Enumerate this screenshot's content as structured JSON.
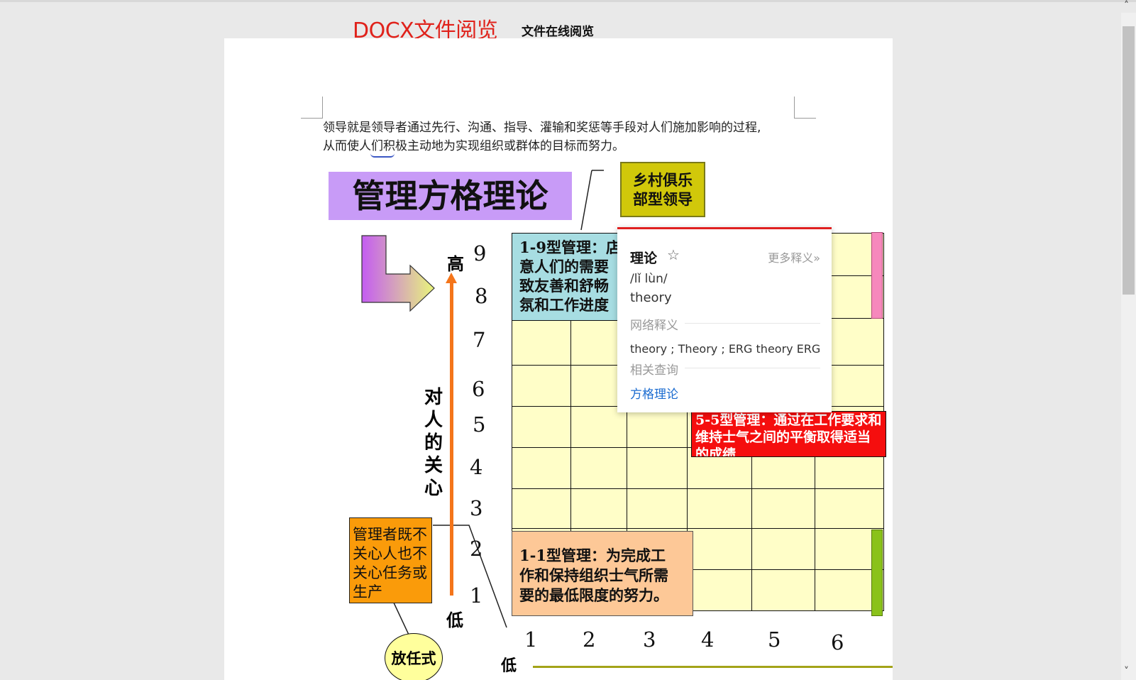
{
  "header": {
    "app_title": "DOCX文件阅览",
    "subtitle": "文件在线阅览"
  },
  "document": {
    "paragraph_line1": "领导就是领导者通过先行、沟通、指导、灌输和奖惩等手段对人们施加影响的过程,",
    "paragraph_line2": "从而使人们积极主动地为实现组织或群体的目标而努力。",
    "figure": {
      "title": "管理方格理论",
      "country_club_line1": "乡村俱乐",
      "country_club_line2": "部型领导",
      "box_1_9": [
        "1-9型管理：店",
        "意人们的需要",
        "致友善和舒畅",
        "氛和工作进度"
      ],
      "box_5_5": [
        "5-5型管理：通过在工作要求和",
        "维持士气之间的平衡取得适当",
        "的成绩"
      ],
      "box_1_1": [
        "1-1型管理：为完成工",
        "作和保持组织士气所需",
        "要的最低限度的努力。"
      ],
      "box_laissez": [
        "管理者既不",
        "关心人也不",
        "关心任务或",
        "生产"
      ],
      "bubble": "放任式",
      "y_high": "高",
      "y_low": "低",
      "x_low": "低",
      "y_axis_label": "对人的关心",
      "y_ticks": [
        "9",
        "8",
        "7",
        "6",
        "5",
        "4",
        "3",
        "2",
        "1"
      ],
      "x_ticks": [
        "1",
        "2",
        "3",
        "4",
        "5",
        "6"
      ]
    }
  },
  "dictionary_popup": {
    "word": "理论",
    "star_icon": "star-outline-icon",
    "more_link": "更多释义»",
    "phonetic": "/lǐ lùn/",
    "definition": "theory",
    "web_section": "网络释义",
    "web_meanings": "theory ; Theory ; ERG theory ERG",
    "related_section": "相关查询",
    "related_link": "方格理论"
  },
  "colors": {
    "title_red": "#e0221b",
    "popup_accent": "#e02020",
    "link_blue": "#1a6bd0"
  }
}
